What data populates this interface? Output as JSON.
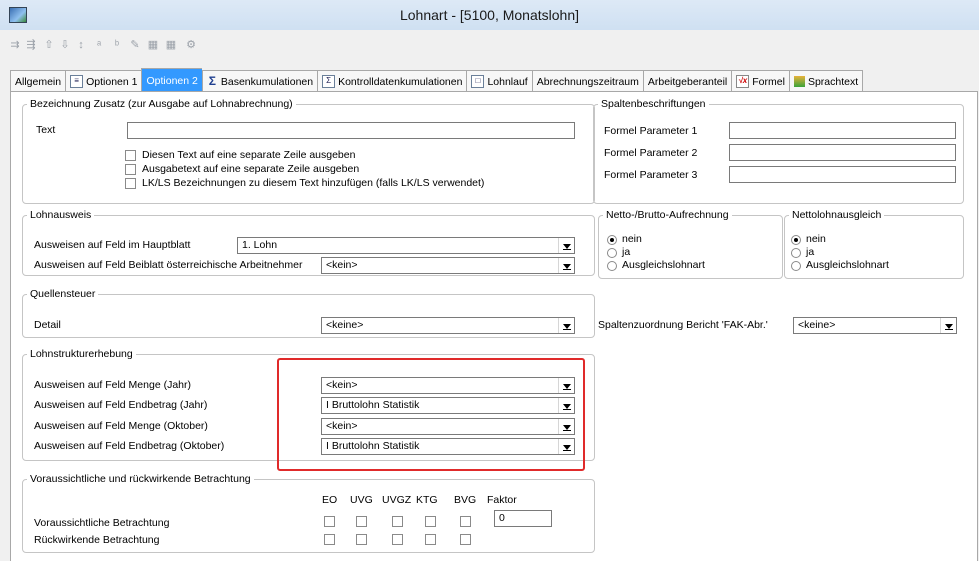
{
  "window": {
    "title": "Lohnart - [5100, Monatslohn]"
  },
  "toolbar_icons": [
    "new-icon",
    "delete-icon",
    "up-icon",
    "down-icon",
    "sort-icon",
    "spell-icon",
    "spell-check-icon",
    "edit-icon",
    "grid-icon",
    "grid2-icon",
    "tools-icon"
  ],
  "tabs": [
    {
      "label": "Allgemein",
      "icon": ""
    },
    {
      "label": "Optionen 1",
      "icon": "page-icon"
    },
    {
      "label": "Optionen 2",
      "icon": ""
    },
    {
      "label": "Basenkumulationen",
      "icon": "sigma-icon"
    },
    {
      "label": "Kontrolldatenkumulationen",
      "icon": "sigma-icon"
    },
    {
      "label": "Lohnlauf",
      "icon": "page-icon"
    },
    {
      "label": "Abrechnungszeitraum",
      "icon": ""
    },
    {
      "label": "Arbeitgeberanteil",
      "icon": ""
    },
    {
      "label": "Formel",
      "icon": "formula-icon"
    },
    {
      "label": "Sprachtext",
      "icon": "people-icon"
    }
  ],
  "zusatz": {
    "legend": "Bezeichnung Zusatz (zur Ausgabe auf Lohnabrechnung)",
    "text_label": "Text",
    "text_value": "",
    "cb1": "Diesen Text auf eine separate Zeile ausgeben",
    "cb2": "Ausgabetext auf eine separate Zeile ausgeben",
    "cb3": "LK/LS Bezeichnungen zu diesem Text hinzufügen (falls LK/LS verwendet)"
  },
  "spalten": {
    "legend": "Spaltenbeschriftungen",
    "p1": "Formel Parameter 1",
    "p2": "Formel Parameter 2",
    "p3": "Formel Parameter 3"
  },
  "lohnausweis": {
    "legend": "Lohnausweis",
    "row1_label": "Ausweisen auf Feld im Hauptblatt",
    "row1_value": "1. Lohn",
    "row2_label": "Ausweisen auf Feld Beiblatt österreichische Arbeitnehmer",
    "row2_value": "<kein>"
  },
  "netto": {
    "legend": "Netto-/Brutto-Aufrechnung",
    "opt1": "nein",
    "opt2": "ja",
    "opt3": "Ausgleichslohnart"
  },
  "nettoausgleich": {
    "legend": "Nettolohnausgleich",
    "opt1": "nein",
    "opt2": "ja",
    "opt3": "Ausgleichslohnart"
  },
  "quellensteuer": {
    "legend": "Quellensteuer",
    "detail_label": "Detail",
    "detail_value": "<keine>"
  },
  "spaltenzuordnung": {
    "label": "Spaltenzuordnung Bericht 'FAK-Abr.'",
    "value": "<keine>"
  },
  "lohnstruktur": {
    "legend": "Lohnstrukturerhebung",
    "rows": [
      {
        "label": "Ausweisen auf Feld Menge (Jahr)",
        "value": "<kein>"
      },
      {
        "label": "Ausweisen auf Feld Endbetrag (Jahr)",
        "value": "I Bruttolohn Statistik"
      },
      {
        "label": "Ausweisen auf Feld Menge (Oktober)",
        "value": "<kein>"
      },
      {
        "label": "Ausweisen auf Feld Endbetrag (Oktober)",
        "value": "I Bruttolohn Statistik"
      }
    ]
  },
  "betrachtung": {
    "legend": "Voraussichtliche und rückwirkende Betrachtung",
    "cols": [
      "EO",
      "UVG",
      "UVGZ",
      "KTG",
      "BVG",
      "Faktor"
    ],
    "row1": "Voraussichtliche Betrachtung",
    "row2": "Rückwirkende Betrachtung",
    "faktor_value": "0"
  }
}
